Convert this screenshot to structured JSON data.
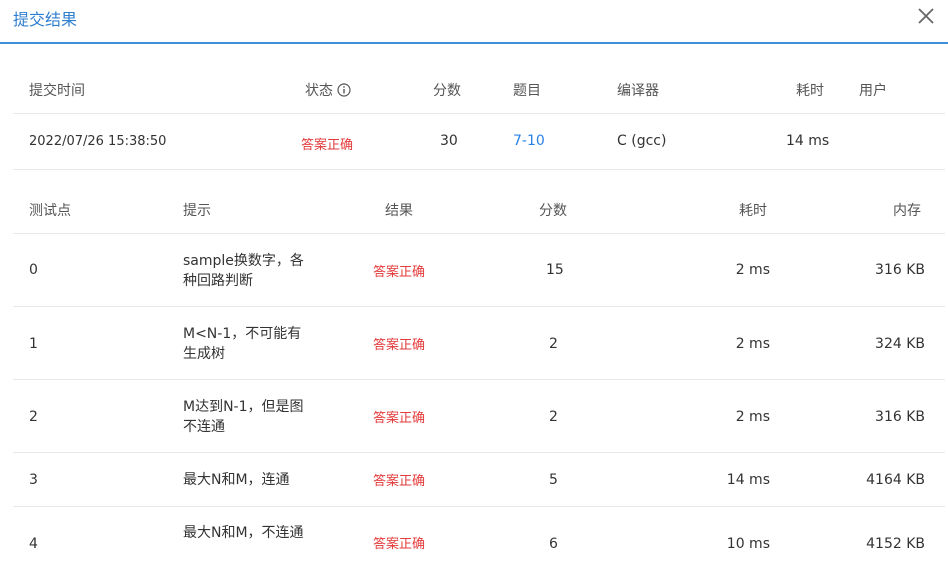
{
  "header": {
    "title": "提交结果"
  },
  "summary": {
    "headers": {
      "time": "提交时间",
      "status": "状态",
      "score": "分数",
      "problem": "题目",
      "compiler": "编译器",
      "duration": "耗时",
      "user": "用户"
    },
    "row": {
      "time": "2022/07/26 15:38:50",
      "status": "答案正确",
      "score": "30",
      "problem": "7-10",
      "compiler": "C (gcc)",
      "duration": "14 ms",
      "user": ""
    }
  },
  "cases": {
    "headers": {
      "id": "测试点",
      "hint": "提示",
      "result": "结果",
      "score": "分数",
      "duration": "耗时",
      "memory": "内存"
    },
    "rows": [
      {
        "id": "0",
        "hint": "sample换数字，各种回路判断",
        "result": "答案正确",
        "score": "15",
        "duration": "2 ms",
        "memory": "316 KB"
      },
      {
        "id": "1",
        "hint": "M<N-1，不可能有生成树",
        "result": "答案正确",
        "score": "2",
        "duration": "2 ms",
        "memory": "324 KB"
      },
      {
        "id": "2",
        "hint": "M达到N-1，但是图不连通",
        "result": "答案正确",
        "score": "2",
        "duration": "2 ms",
        "memory": "316 KB"
      },
      {
        "id": "3",
        "hint": "最大N和M，连通",
        "result": "答案正确",
        "score": "5",
        "duration": "14 ms",
        "memory": "4164 KB"
      },
      {
        "id": "4",
        "hint": "最大N和M，不连通",
        "result": "答案正确",
        "score": "6",
        "duration": "10 ms",
        "memory": "4152 KB"
      }
    ]
  },
  "colors": {
    "accent": "#2f7fd0",
    "success": "#e33a3a",
    "link": "#2a82e4"
  },
  "icons": {
    "close": "close-icon",
    "info": "info-icon"
  }
}
